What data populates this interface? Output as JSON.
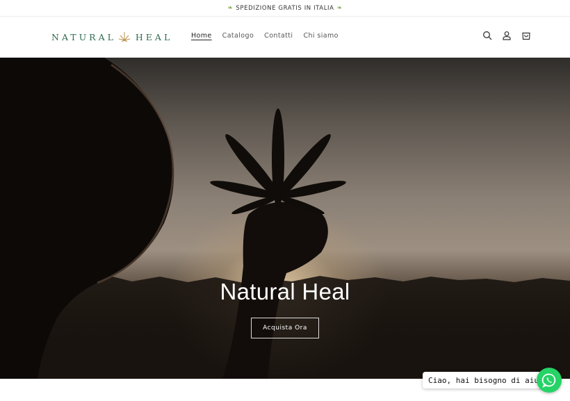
{
  "announcement": {
    "text": "SPEDIZIONE GRATIS IN ITALIA",
    "icon": "leaf-icon"
  },
  "header": {
    "logo_left": "NATURAL",
    "logo_right": "HEAL",
    "nav": [
      {
        "label": "Home",
        "active": true
      },
      {
        "label": "Catalogo",
        "active": false
      },
      {
        "label": "Contatti",
        "active": false
      },
      {
        "label": "Chi siamo",
        "active": false
      }
    ],
    "icons": [
      "search-icon",
      "account-icon",
      "cart-icon"
    ]
  },
  "hero": {
    "title": "Natural Heal",
    "button_label": "Acquista Ora"
  },
  "chat": {
    "bubble_text": "Ciao, hai bisogno di aiuto?",
    "icon": "whatsapp-icon"
  },
  "colors": {
    "brand_green": "#2f6b4f",
    "whatsapp_green": "#25d366",
    "leaf_green": "#7ba44a"
  }
}
